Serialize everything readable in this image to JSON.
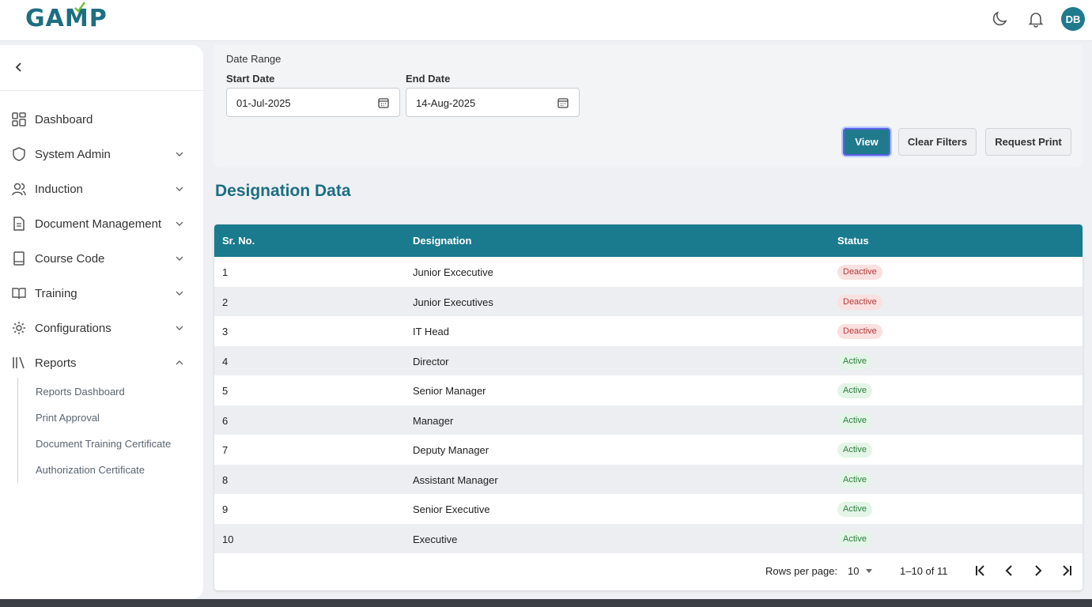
{
  "app": {
    "logo_text": "GAMP",
    "avatar_initials": "DB"
  },
  "topbar_icons": [
    "moon-icon",
    "bell-icon"
  ],
  "sidebar": {
    "items": [
      {
        "label": "Dashboard",
        "icon": "dashboard-icon",
        "expandable": false
      },
      {
        "label": "System Admin",
        "icon": "shield-icon",
        "expandable": true
      },
      {
        "label": "Induction",
        "icon": "users-icon",
        "expandable": true
      },
      {
        "label": "Document Management",
        "icon": "document-icon",
        "expandable": true
      },
      {
        "label": "Course Code",
        "icon": "book-closed-icon",
        "expandable": true
      },
      {
        "label": "Training",
        "icon": "book-open-icon",
        "expandable": true
      },
      {
        "label": "Configurations",
        "icon": "gear-icon",
        "expandable": true
      },
      {
        "label": "Reports",
        "icon": "library-icon",
        "expandable": true,
        "expanded": true
      }
    ],
    "report_subitems": [
      "Reports Dashboard",
      "Print Approval",
      "Document Training Certificate",
      "Authorization Certificate"
    ]
  },
  "filters": {
    "section_label": "Date Range",
    "start_label": "Start Date",
    "start_value": "01-Jul-2025",
    "end_label": "End Date",
    "end_value": "14-Aug-2025",
    "view_label": "View",
    "clear_label": "Clear Filters",
    "print_label": "Request Print"
  },
  "section_title": "Designation Data",
  "table": {
    "headers": {
      "sr": "Sr. No.",
      "designation": "Designation",
      "status": "Status"
    },
    "rows": [
      {
        "sr": "1",
        "designation": "Junior Excecutive",
        "status": "Deactive"
      },
      {
        "sr": "2",
        "designation": "Junior Executives",
        "status": "Deactive"
      },
      {
        "sr": "3",
        "designation": "IT Head",
        "status": "Deactive"
      },
      {
        "sr": "4",
        "designation": "Director",
        "status": "Active"
      },
      {
        "sr": "5",
        "designation": "Senior Manager",
        "status": "Active"
      },
      {
        "sr": "6",
        "designation": "Manager",
        "status": "Active"
      },
      {
        "sr": "7",
        "designation": "Deputy Manager",
        "status": "Active"
      },
      {
        "sr": "8",
        "designation": "Assistant Manager",
        "status": "Active"
      },
      {
        "sr": "9",
        "designation": "Senior Executive",
        "status": "Active"
      },
      {
        "sr": "10",
        "designation": "Executive",
        "status": "Active"
      }
    ]
  },
  "pagination": {
    "rows_label": "Rows per page:",
    "rows_value": "10",
    "range": "1–10 of 11"
  },
  "colors": {
    "primary": "#1f7a8c",
    "header": "#1a7a8e",
    "deactive_bg": "#fbe0e0",
    "active_bg": "#e2f5e6"
  }
}
